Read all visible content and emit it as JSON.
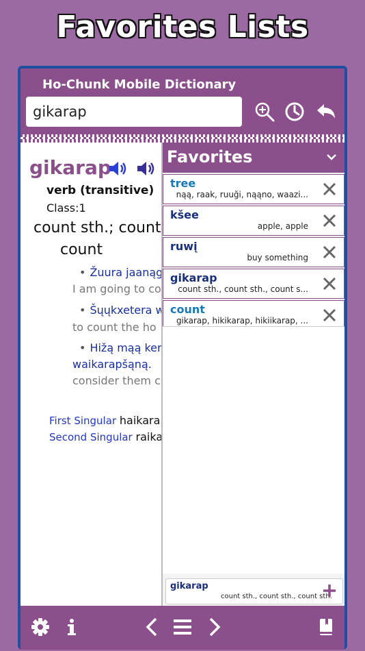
{
  "promo": {
    "title": "Favorites Lists"
  },
  "app": {
    "title": "Ho-Chunk Mobile Dictionary"
  },
  "search": {
    "value": "gikarap"
  },
  "header_icons": [
    "zoom-in-icon",
    "history-icon",
    "back-icon"
  ],
  "entry": {
    "headword": "gikarap",
    "part_of_speech": "verb (transitive)",
    "class": "Class:1",
    "definition_line1": "count sth.; count",
    "definition_line2": "count",
    "examples": [
      {
        "hocak": "Žuura jaanąg",
        "english": "I am going to co"
      },
      {
        "hocak": "Šųųkxetera w",
        "english": "to count the ho"
      },
      {
        "hocak": "Hižą mąą ker",
        "hocak2": "waikarapšąną.",
        "english": "consider them c"
      }
    ],
    "conjugations": [
      {
        "label": "First Singular",
        "value": "haikarap"
      },
      {
        "label": "Second Singular",
        "value": "raikar"
      }
    ]
  },
  "favorites": {
    "title": "Favorites",
    "items": [
      {
        "word": "tree",
        "gloss": "nąą, raak, ruuği, nąąno, waazi..."
      },
      {
        "word": "kšee",
        "gloss": "apple, apple"
      },
      {
        "word": "ruwį",
        "gloss": "buy something"
      },
      {
        "word": "gikarap",
        "gloss": "count sth., count sth., count s..."
      },
      {
        "word": "count",
        "gloss": "gikarap, hikikarap, hikiikarap, ..."
      }
    ],
    "current": {
      "word": "gikarap",
      "gloss": "count sth., count sth., count sth."
    }
  },
  "colors": {
    "brand_purple": "#8b4f8c",
    "frame_blue": "#1f4fa1",
    "background": "#9b6aa3",
    "headword": "#8b4f8c",
    "link_blue": "#1a7ab8"
  },
  "toolbar_icons": [
    "settings-icon",
    "info-icon",
    "previous-icon",
    "menu-icon",
    "next-icon",
    "dictionary-book-icon"
  ]
}
